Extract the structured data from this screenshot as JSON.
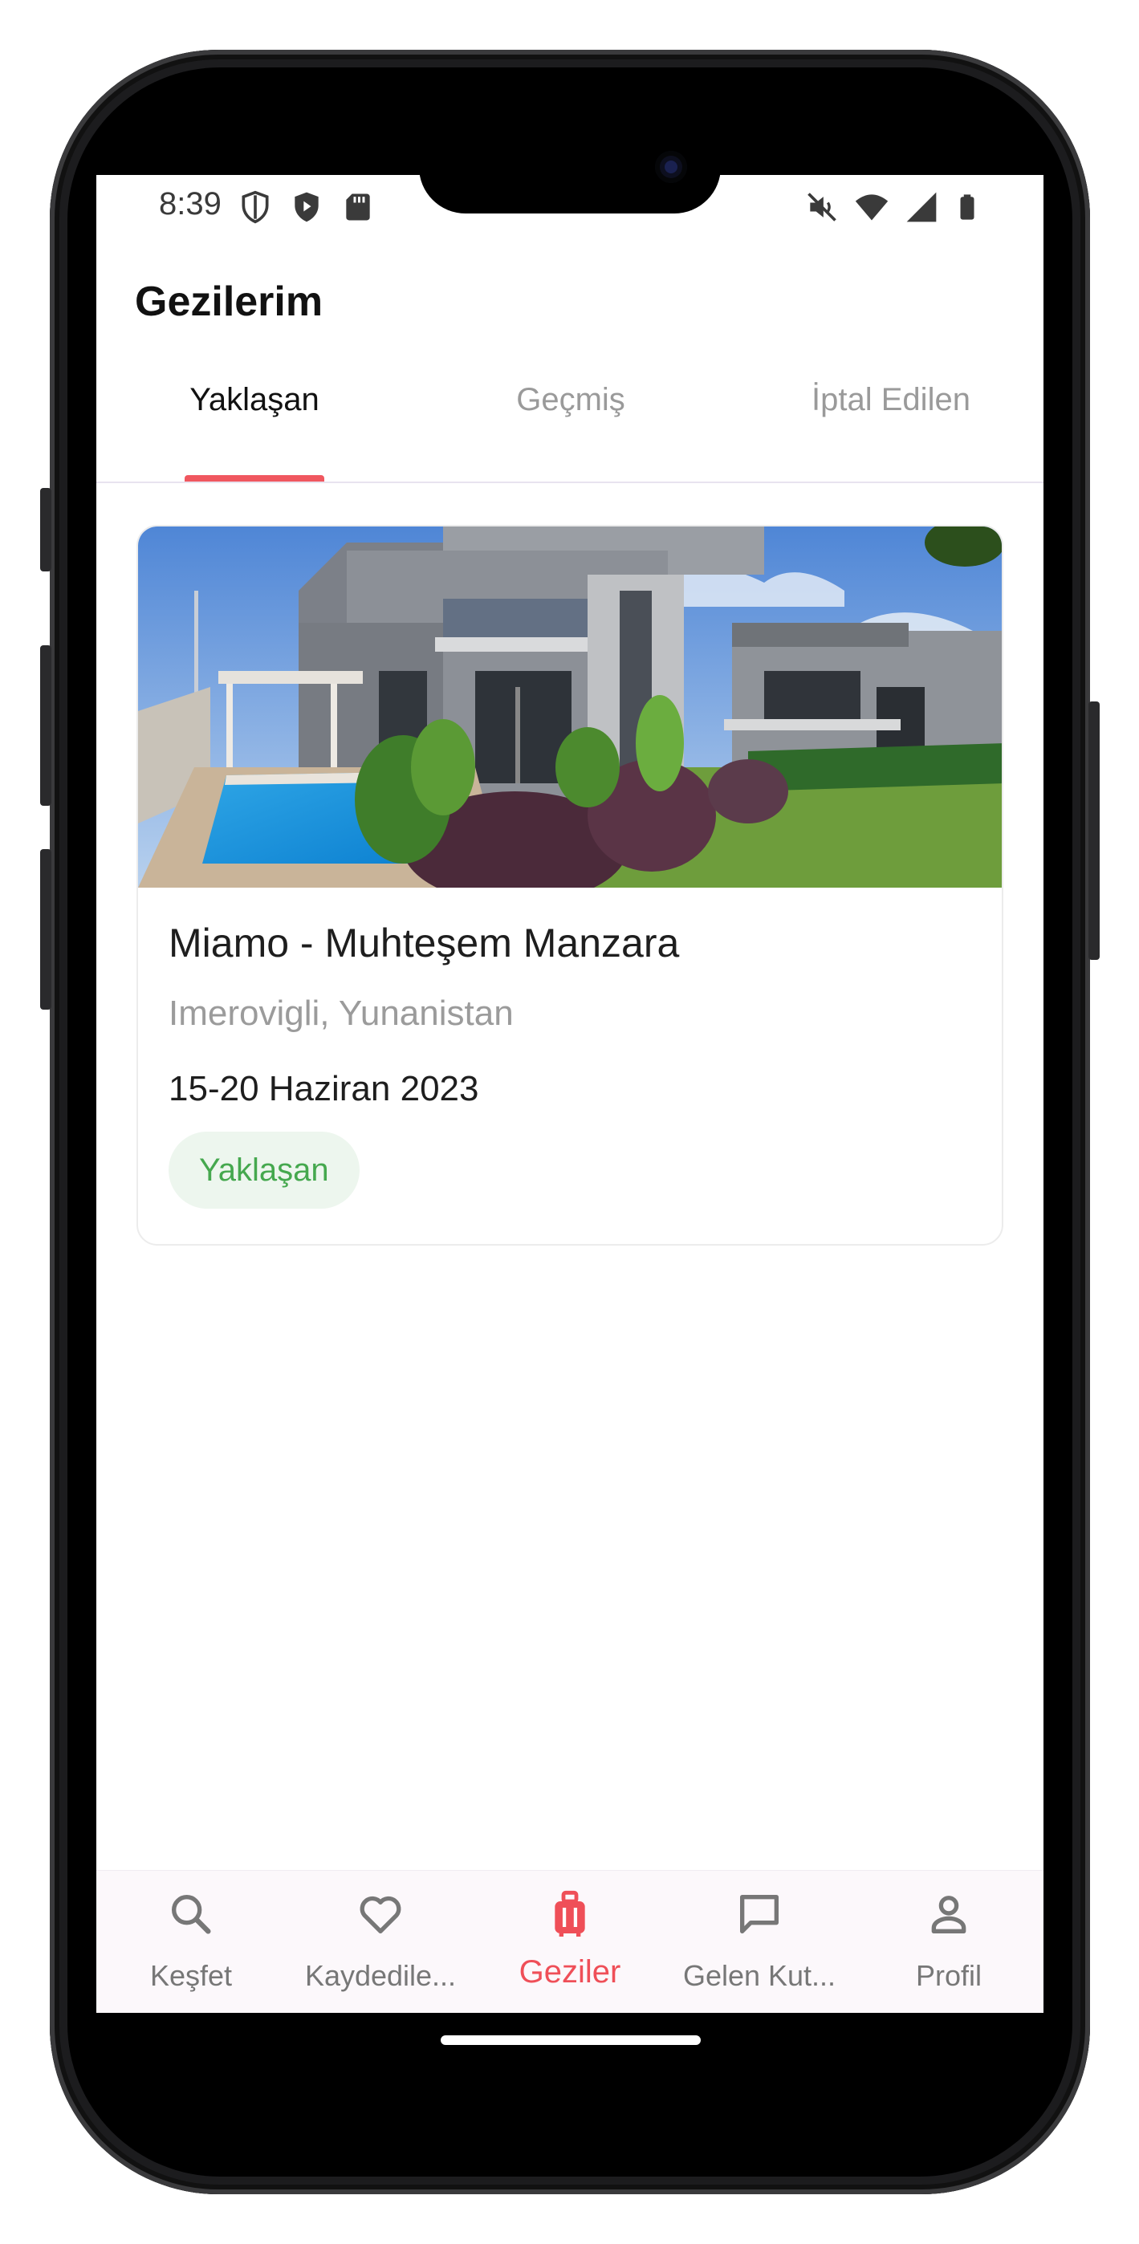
{
  "status_bar": {
    "time": "8:39",
    "left_icons": [
      "shield-outline-icon",
      "shield-play-icon",
      "sd-card-icon"
    ],
    "right_icons": [
      "mute-icon",
      "wifi-icon",
      "signal-icon",
      "battery-icon"
    ]
  },
  "header": {
    "title": "Gezilerim"
  },
  "tabs": [
    {
      "label": "Yaklaşan",
      "active": true
    },
    {
      "label": "Geçmiş",
      "active": false
    },
    {
      "label": "İptal Edilen",
      "active": false
    }
  ],
  "trips": [
    {
      "name": "Miamo - Muhteşem Manzara",
      "location": "Imerovigli, Yunanistan",
      "dates": "15-20 Haziran 2023",
      "status": "Yaklaşan"
    }
  ],
  "bottom_nav": [
    {
      "label": "Keşfet",
      "icon": "search-icon",
      "active": false
    },
    {
      "label": "Kaydedile...",
      "icon": "heart-icon",
      "active": false
    },
    {
      "label": "Geziler",
      "icon": "luggage-icon",
      "active": true
    },
    {
      "label": "Gelen Kut...",
      "icon": "chat-icon",
      "active": false
    },
    {
      "label": "Profil",
      "icon": "person-icon",
      "active": false
    }
  ],
  "colors": {
    "accent": "#f0575f",
    "status_green": "#45a84e",
    "status_green_bg": "#edf6ee",
    "inactive_tab": "#9a9a9a"
  }
}
